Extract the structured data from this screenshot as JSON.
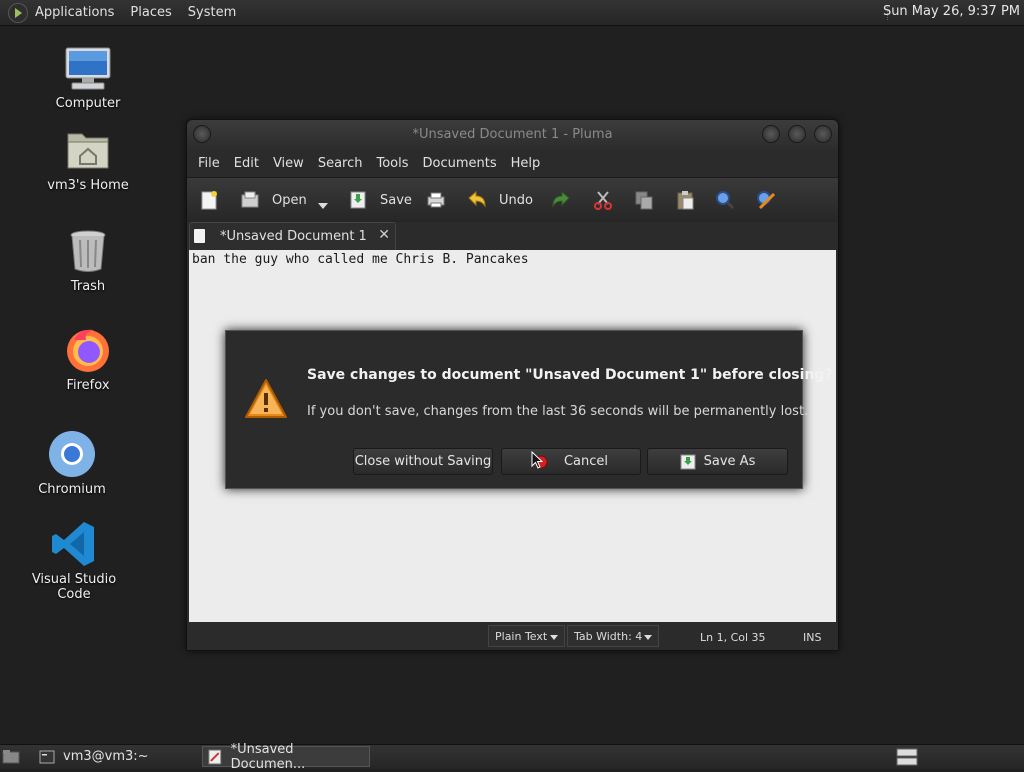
{
  "top_panel": {
    "menus": [
      "Applications",
      "Places",
      "System"
    ],
    "clock": "Sun May 26,  9:37 PM"
  },
  "desktop_icons": [
    {
      "label": "Computer",
      "icon": "computer-icon"
    },
    {
      "label": "vm3's Home",
      "icon": "home-folder-icon"
    },
    {
      "label": "Trash",
      "icon": "trash-icon"
    },
    {
      "label": "Firefox",
      "icon": "firefox-icon"
    },
    {
      "label": "Chromium",
      "icon": "chromium-icon"
    },
    {
      "label": "Visual Studio Code",
      "icon": "vscode-icon"
    }
  ],
  "window": {
    "title": "*Unsaved Document 1 - Pluma",
    "menu": [
      "File",
      "Edit",
      "View",
      "Search",
      "Tools",
      "Documents",
      "Help"
    ],
    "toolbar": {
      "open_label": "Open",
      "save_label": "Save",
      "undo_label": "Undo"
    },
    "tab": {
      "label": "*Unsaved Document 1",
      "close": "✕"
    },
    "editor_text": "ban the guy who called me Chris B. Pancakes",
    "statusbar": {
      "syntax": "Plain Text",
      "tab_width": "Tab Width:  4",
      "position": "Ln 1, Col 35",
      "mode": "INS"
    }
  },
  "dialog": {
    "title": "Save changes to document \"Unsaved Document 1\" before closing?",
    "message": "If you don't save, changes from the last 36 seconds will be permanently lost.",
    "buttons": {
      "close_without_saving": "Close without Saving",
      "cancel": "Cancel",
      "save_as": "Save As"
    }
  },
  "taskbar": {
    "tasks": [
      "vm3@vm3:~",
      "*Unsaved Documen..."
    ]
  },
  "colors": {
    "panel_bg": "#2b2b2b",
    "desktop_bg": "#202020",
    "editor_bg": "#ececec",
    "warning_orange": "#e8891a"
  }
}
